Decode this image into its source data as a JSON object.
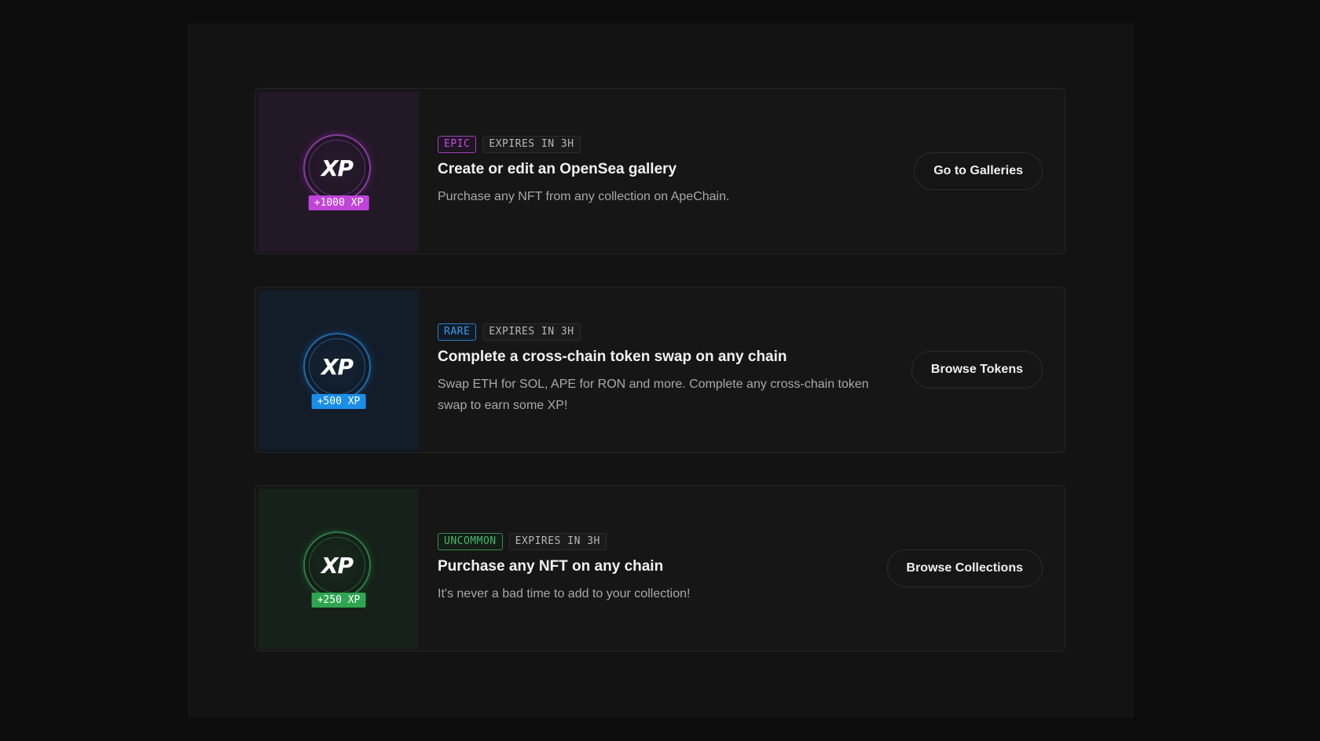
{
  "quests": [
    {
      "rarity": "EPIC",
      "expires": "EXPIRES IN 3H",
      "icon_text": "XP",
      "xp_reward": "+1000 XP",
      "title": "Create or edit an OpenSea gallery",
      "description": "Purchase any NFT from any collection on ApeChain.",
      "button_label": "Go to Galleries",
      "accent_color": "#c044d8"
    },
    {
      "rarity": "RARE",
      "expires": "EXPIRES IN 3H",
      "icon_text": "XP",
      "xp_reward": "+500 XP",
      "title": "Complete a cross-chain token swap on any chain",
      "description": "Swap ETH for SOL, APE for RON and more. Complete any cross-chain token swap to earn some XP!",
      "button_label": "Browse Tokens",
      "accent_color": "#1a8ee8"
    },
    {
      "rarity": "UNCOMMON",
      "expires": "EXPIRES IN 3H",
      "icon_text": "XP",
      "xp_reward": "+250 XP",
      "title": "Purchase any NFT on any chain",
      "description": "It's never a bad time to add to your collection!",
      "button_label": "Browse Collections",
      "accent_color": "#2fa552"
    }
  ]
}
